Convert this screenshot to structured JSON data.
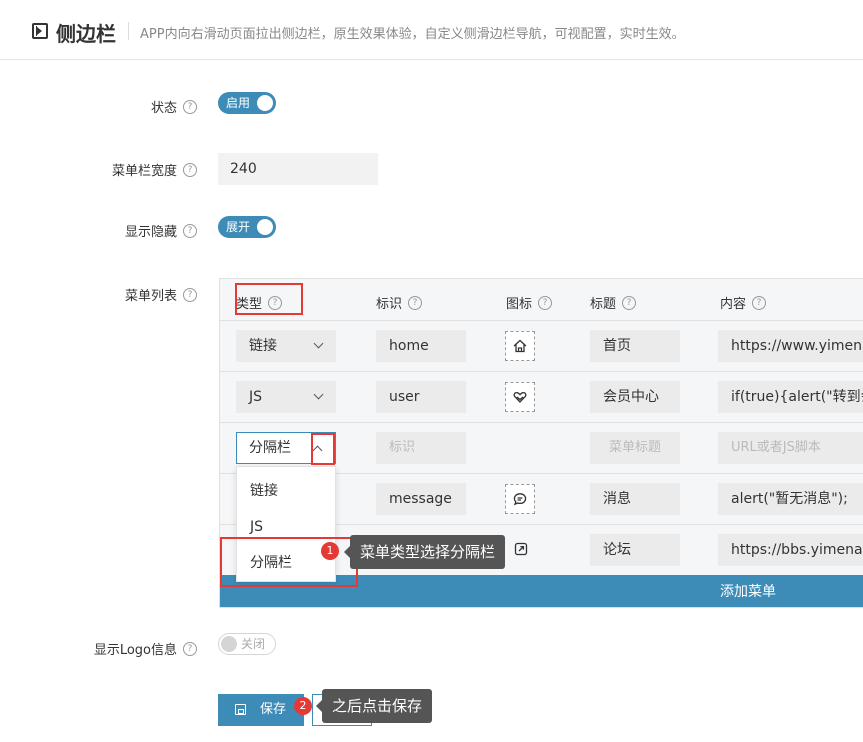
{
  "header": {
    "title": "侧边栏",
    "description": "APP内向右滑动页面拉出侧边栏，原生效果体验，自定义侧滑边栏导航，可视配置，实时生效。"
  },
  "form": {
    "status_label": "状态",
    "status_toggle": "启用",
    "width_label": "菜单栏宽度",
    "width_value": "240",
    "visibility_label": "显示隐藏",
    "visibility_toggle": "展开",
    "menu_list_label": "菜单列表",
    "logo_label": "显示Logo信息",
    "logo_toggle": "关闭"
  },
  "table": {
    "columns": [
      "类型",
      "标识",
      "图标",
      "标题",
      "内容"
    ],
    "rows": [
      {
        "type": "链接",
        "id": "home",
        "icon": "home-icon",
        "title": "首页",
        "content": "https://www.yimenap"
      },
      {
        "type": "JS",
        "id": "user",
        "icon": "heart-icon",
        "title": "会员中心",
        "content": "if(true){alert(\"转到会"
      },
      {
        "type": "分隔栏",
        "id_placeholder": "标识",
        "title_placeholder": "菜单标题",
        "content_placeholder": "URL或者JS脚本"
      },
      {
        "id": "message",
        "icon": "chat-icon",
        "title": "消息",
        "content": "alert(\"暂无消息\");"
      },
      {
        "icon": "external-link-icon",
        "title": "论坛",
        "content": "https://bbs.yimenapp"
      }
    ],
    "add_button": "添加菜单"
  },
  "dropdown": {
    "options": [
      "链接",
      "JS",
      "分隔栏"
    ]
  },
  "annotations": [
    {
      "number": "1",
      "text": "菜单类型选择分隔栏"
    },
    {
      "number": "2",
      "text": "之后点击保存"
    }
  ],
  "footer": {
    "save_label": "保存"
  },
  "colors": {
    "accent": "#3d8cb8",
    "highlight": "#e53935"
  }
}
